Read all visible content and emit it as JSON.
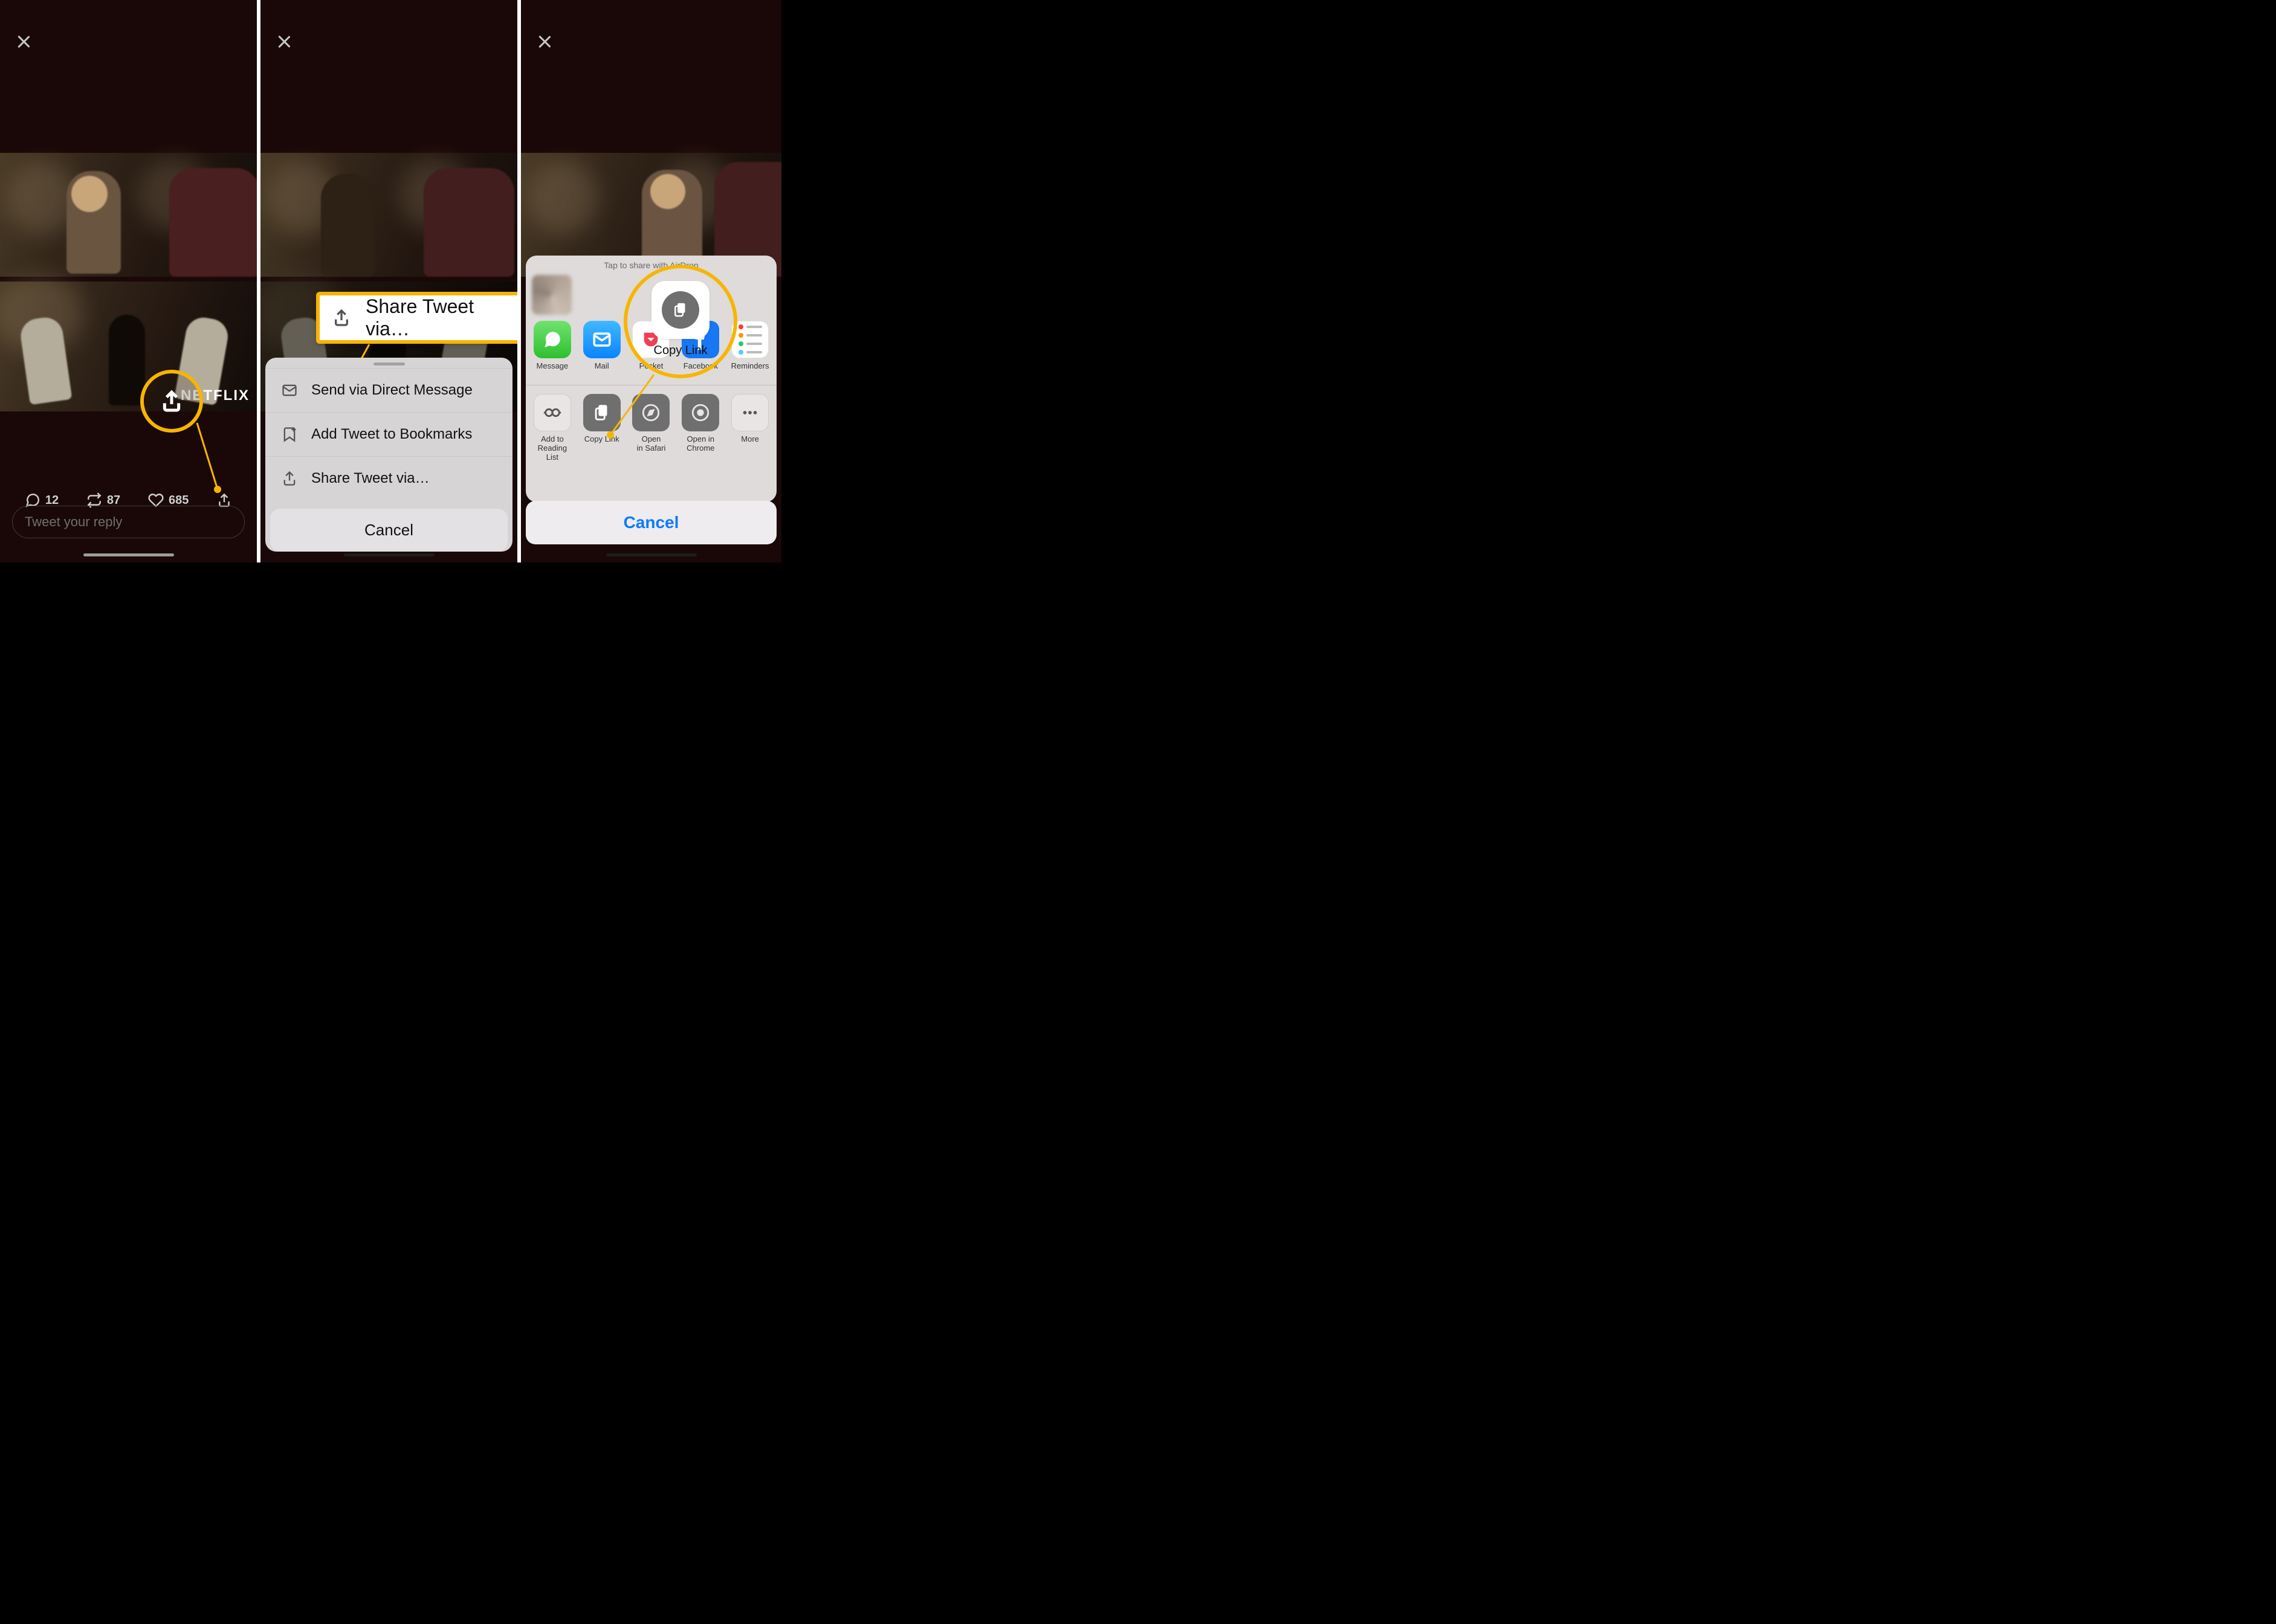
{
  "panel1": {
    "netflix_logo": "NETFLIX",
    "counts": {
      "replies": "12",
      "retweets": "87",
      "likes": "685"
    },
    "reply_placeholder": "Tweet your reply"
  },
  "panel2": {
    "highlight_label": "Share Tweet via…",
    "menu": {
      "dm": "Send via Direct Message",
      "bookmark": "Add Tweet to Bookmarks",
      "share": "Share Tweet via…",
      "cancel": "Cancel"
    }
  },
  "panel3": {
    "airdrop_hint": "Tap to share with AirDrop",
    "highlight_label": "Copy Link",
    "apps": {
      "message": "Message",
      "mail": "Mail",
      "pocket": "Pocket",
      "facebook": "Facebook",
      "reminders": "Reminders"
    },
    "actions": {
      "reading_list": "Add to\nReading List",
      "copy_link": "Copy Link",
      "open_safari": "Open\nin Safari",
      "open_chrome": "Open in\nChrome",
      "more": "More"
    },
    "cancel": "Cancel"
  }
}
